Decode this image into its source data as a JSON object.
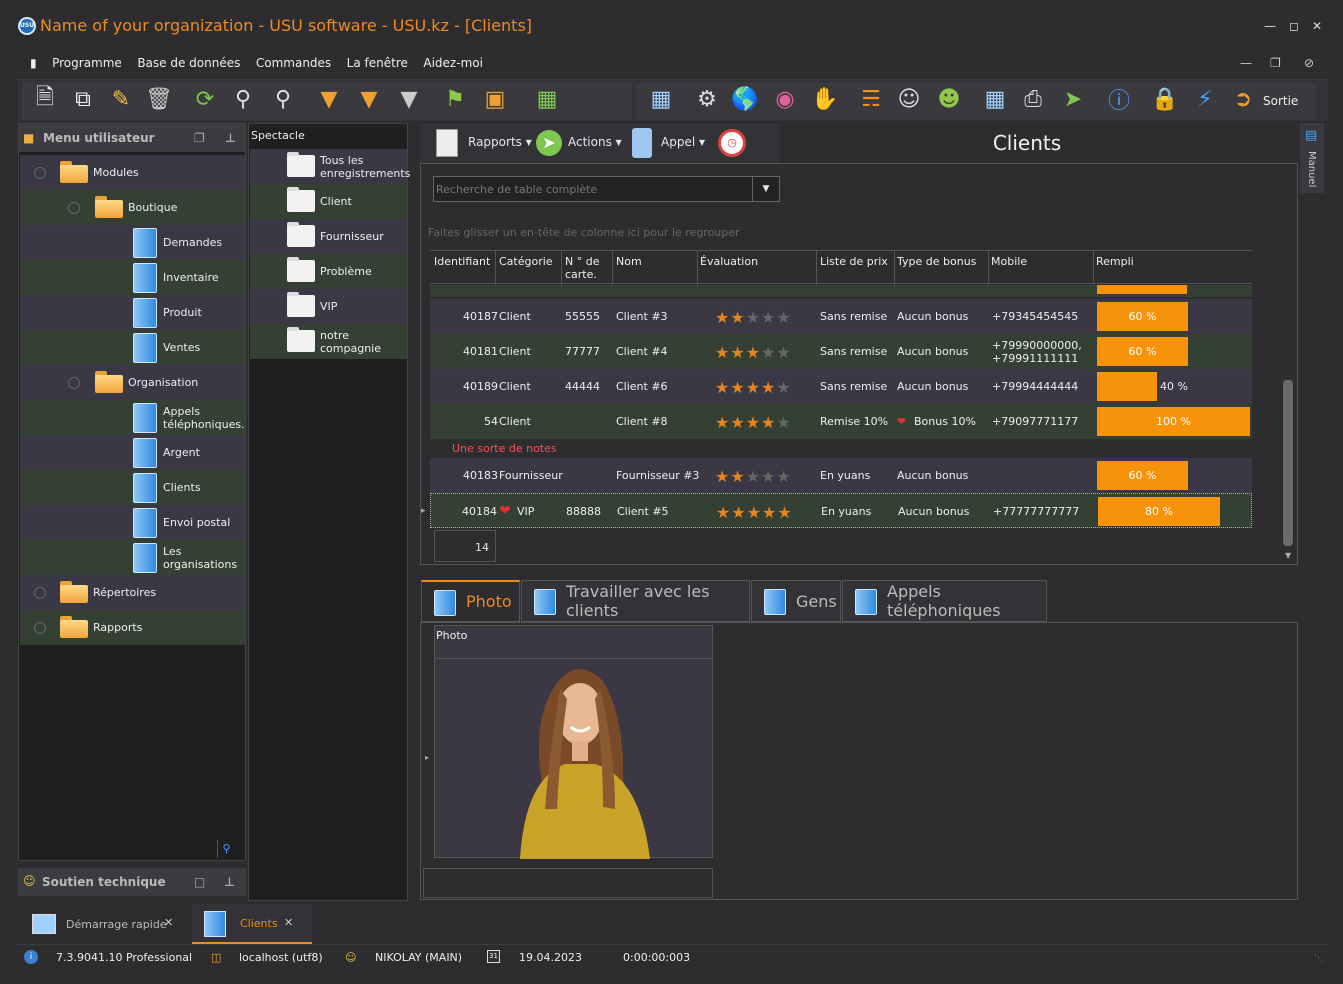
{
  "window": {
    "title": "Name of your organization - USU software - USU.kz - [Clients]",
    "logo": "USU"
  },
  "menu": [
    "Programme",
    "Base de données",
    "Commandes",
    "La fenêtre",
    "Aidez-moi"
  ],
  "toolbar": {
    "exit_label": "Sortie"
  },
  "left_panel": {
    "title": "Menu utilisateur",
    "items": [
      {
        "label": "Modules",
        "icon": "folder-open-icon"
      },
      {
        "label": "Boutique",
        "icon": "folder-open-icon"
      },
      {
        "label": "Demandes",
        "icon": "document-icon"
      },
      {
        "label": "Inventaire",
        "icon": "document-icon"
      },
      {
        "label": "Produit",
        "icon": "document-icon"
      },
      {
        "label": "Ventes",
        "icon": "document-icon"
      },
      {
        "label": "Organisation",
        "icon": "folder-open-icon"
      },
      {
        "label": "Appels téléphoniques.",
        "icon": "document-icon"
      },
      {
        "label": "Argent",
        "icon": "document-icon"
      },
      {
        "label": "Clients",
        "icon": "document-icon"
      },
      {
        "label": "Envoi postal",
        "icon": "document-icon"
      },
      {
        "label": "Les organisations",
        "icon": "document-icon"
      },
      {
        "label": "Répertoires",
        "icon": "folder-icon"
      },
      {
        "label": "Rapports",
        "icon": "folder-icon"
      }
    ]
  },
  "support": {
    "title": "Soutien technique"
  },
  "mid_panel": {
    "title": "Spectacle",
    "items": [
      "Tous les enregistrements",
      "Client",
      "Fournisseur",
      "Problème",
      "VIP",
      "notre compagnie"
    ]
  },
  "ribbon": {
    "reports": "Rapports",
    "actions": "Actions",
    "call": "Appel"
  },
  "page_title": "Clients",
  "manual_tab": "Manuel",
  "search": {
    "placeholder": "Recherche de table complète"
  },
  "group_hint": "Faites glisser un en-tête de colonne ici pour le regrouper",
  "grid": {
    "columns": [
      "Identifiant",
      "Catégorie",
      "N ° de carte.",
      "Nom",
      "Évaluation",
      "Liste de prix",
      "Type de bonus",
      "Mobile",
      "Rempli"
    ],
    "rows": [
      {
        "id": "40187",
        "category": "Client",
        "card": "55555",
        "name": "Client #3",
        "rating": 2,
        "price_list": "Sans remise",
        "bonus": "Aucun bonus",
        "mobile": "+79345454545",
        "filled": 60,
        "filled_label": "60 %"
      },
      {
        "id": "40181",
        "category": "Client",
        "card": "77777",
        "name": "Client #4",
        "rating": 3,
        "price_list": "Sans remise",
        "bonus": "Aucun bonus",
        "mobile": "+79990000000, +79991111111",
        "filled": 60,
        "filled_label": "60 %"
      },
      {
        "id": "40189",
        "category": "Client",
        "card": "44444",
        "name": "Client #6",
        "rating": 4,
        "price_list": "Sans remise",
        "bonus": "Aucun bonus",
        "mobile": "+79994444444",
        "filled": 40,
        "filled_label": "40 %"
      },
      {
        "id": "54",
        "category": "Client",
        "card": "",
        "name": "Client #8",
        "rating": 4,
        "price_list": "Remise 10%",
        "bonus": "Bonus 10%",
        "mobile": "+79097771177",
        "filled": 100,
        "filled_label": "100 %"
      }
    ],
    "group_label": "Une sorte de notes",
    "rows2": [
      {
        "id": "40183",
        "category": "Fournisseur",
        "card": "",
        "name": "Fournisseur #3",
        "rating": 2,
        "price_list": "En yuans",
        "bonus": "Aucun bonus",
        "mobile": "",
        "filled": 60,
        "filled_label": "60 %"
      },
      {
        "id": "40184",
        "category": "VIP",
        "card": "88888",
        "name": "Client #5",
        "rating": 5,
        "price_list": "En yuans",
        "bonus": "Aucun bonus",
        "mobile": "+77777777777",
        "filled": 80,
        "filled_label": "80 %"
      }
    ],
    "count": "14"
  },
  "tabs": [
    "Photo",
    "Travailler avec les clients",
    "Gens",
    "Appels téléphoniques"
  ],
  "photo_label": "Photo",
  "bottom_tabs": [
    {
      "label": "Démarrage rapide"
    },
    {
      "label": "Clients"
    }
  ],
  "status": {
    "version": "7.3.9041.10 Professional",
    "db": "localhost (utf8)",
    "user": "NIKOLAY (MAIN)",
    "date": "19.04.2023",
    "timer": "0:00:00:003",
    "calendar_day": "31"
  },
  "colors": {
    "accent": "#f08a1c",
    "bar": "#f7930a",
    "star": "#e8841c"
  }
}
